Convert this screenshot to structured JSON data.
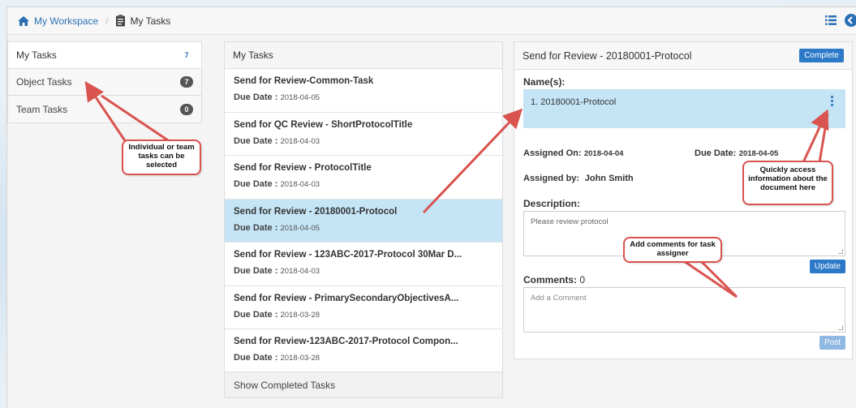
{
  "breadcrumb": {
    "workspace": "My Workspace",
    "separator": "/",
    "current": "My Tasks"
  },
  "left_nav": {
    "items": [
      {
        "label": "My Tasks",
        "count": "7"
      },
      {
        "label": "Object Tasks",
        "count": "7"
      },
      {
        "label": "Team Tasks",
        "count": "0"
      }
    ]
  },
  "task_list": {
    "header": "My Tasks",
    "due_label": "Due Date :",
    "tasks": [
      {
        "title": "Send for Review-Common-Task",
        "due": "2018-04-05"
      },
      {
        "title": "Send for QC Review - ShortProtocolTitle",
        "due": "2018-04-03"
      },
      {
        "title": "Send for Review - ProtocolTitle",
        "due": "2018-04-03"
      },
      {
        "title": "Send for Review - 20180001-Protocol",
        "due": "2018-04-05"
      },
      {
        "title": "Send for Review - 123ABC-2017-Protocol 30Mar D...",
        "due": "2018-04-03"
      },
      {
        "title": "Send for Review - PrimarySecondaryObjectivesA...",
        "due": "2018-03-28"
      },
      {
        "title": "Send for Review-123ABC-2017-Protocol Compon...",
        "due": "2018-03-28"
      }
    ],
    "show_completed": "Show Completed Tasks"
  },
  "detail": {
    "title": "Send for Review - 20180001-Protocol",
    "complete_button": "Complete",
    "names_label": "Name(s):",
    "name_item": "1. 20180001-Protocol",
    "assigned_on_label": "Assigned On:",
    "assigned_on": "2018-04-04",
    "due_date_label": "Due Date:",
    "due_date": "2018-04-05",
    "assigned_by_label": "Assigned by:",
    "assigned_by": "John Smith",
    "description_label": "Description:",
    "description": "Please review protocol",
    "update_button": "Update",
    "comments_label": "Comments:",
    "comments_count": "0",
    "comment_placeholder": "Add a Comment",
    "post_button": "Post"
  },
  "callouts": {
    "individual": "Individual or team tasks can be selected",
    "quick_access": "Quickly access information about the document here",
    "comments": "Add comments for task assigner"
  },
  "colors": {
    "link": "#2a6fb3",
    "selected_row": "#c5e5f6",
    "primary_button": "#2b79c7",
    "callout_border": "#d9534f"
  },
  "icons": [
    "home-icon",
    "tasks-icon",
    "list-icon",
    "user-icon",
    "kebab-menu-icon"
  ]
}
